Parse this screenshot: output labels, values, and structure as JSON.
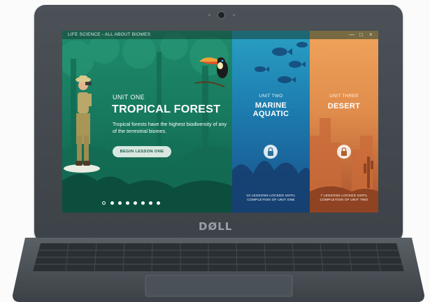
{
  "app": {
    "title": "LIFE SCIENCE - ALL ABOUT BIOMES",
    "window_controls": [
      "—",
      "□",
      "×"
    ]
  },
  "units": [
    {
      "label": "UNIT ONE",
      "title": "TROPICAL FOREST",
      "description": "Tropical forests have the highest biodiversity of any of the terrestrial biomes.",
      "button_label": "BEGIN LESSON ONE"
    },
    {
      "label": "UNIT TWO",
      "title_line1": "MARINE",
      "title_line2": "AQUATIC",
      "locked_note_line1": "10 LESSONS LOCKED UNTIL",
      "locked_note_line2": "COMPLETION OF UNIT ONE"
    },
    {
      "label": "UNIT THREE",
      "title": "DESERT",
      "locked_note_line1": "7 LESSONS LOCKED UNTIL",
      "locked_note_line2": "COMPLETION OF UNIT TWO"
    }
  ],
  "pagination": {
    "total": 8,
    "active": 1
  },
  "laptop_logo": "DØLL",
  "colors": {
    "forest": "#177a5f",
    "marine": "#1d7fb0",
    "desert": "#e08c4c",
    "laptop": "#41474c"
  }
}
